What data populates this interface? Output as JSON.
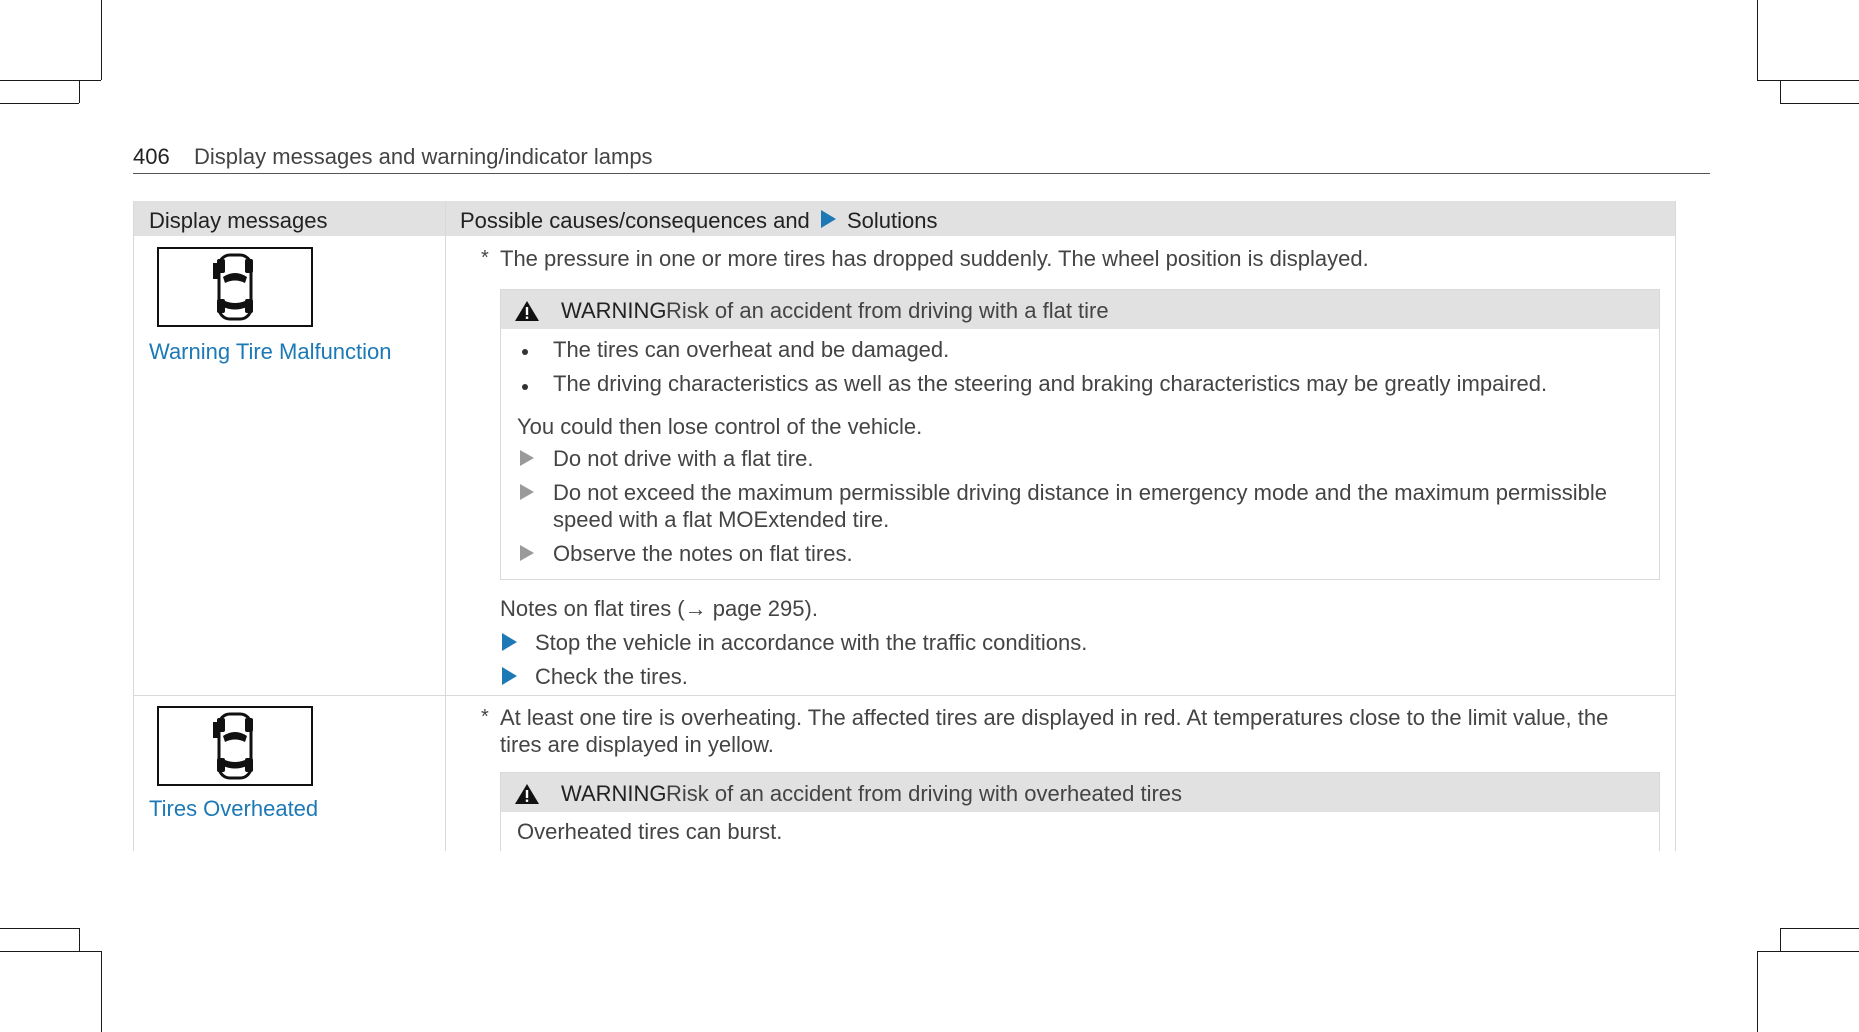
{
  "header": {
    "page_number": "406",
    "title": "Display messages and warning/indicator lamps"
  },
  "table": {
    "col1_header": "Display messages",
    "col2_header_a": "Possible causes/consequences and",
    "col2_header_b": "Solutions"
  },
  "row1": {
    "icon": "tire-pressure-vehicle-icon",
    "message": "Warning Tire Malfunction",
    "star": "*",
    "cause": "The pressure in one or more tires has dropped suddenly. The wheel position is displayed.",
    "warning_word": "WARNING",
    "warning_text": "Risk of an accident from driving with a flat tire",
    "bullets": [
      "The tires can overheat and be damaged.",
      "The driving characteristics as well as the steering and braking characteristics may be greatly impaired."
    ],
    "consequence": "You could then lose control of the vehicle.",
    "actions": [
      "Do not drive with a flat tire.",
      "Do not exceed the maximum permissible driving distance in emergency mode and the maximum permissible",
      "speed with a flat MOExtended tire.",
      "Observe the notes on flat tires."
    ],
    "note": "Notes on flat tires (→ page 295).",
    "solutions": [
      "Stop the vehicle in accordance with the traffic conditions.",
      "Check the tires."
    ]
  },
  "row2": {
    "icon": "tire-temperature-vehicle-icon",
    "message": "Tires Overheated",
    "star": "*",
    "cause_line1": "At least one tire is overheating. The affected tires are displayed in red. At temperatures close to the limit value, the",
    "cause_line2": "tires are displayed in yellow.",
    "warning_word": "WARNING",
    "warning_text": "Risk of an accident from driving with overheated tires",
    "warning_body": "Overheated tires can burst."
  },
  "colors": {
    "accent": "#1c79b6",
    "header_bg": "#e1e1e1"
  }
}
